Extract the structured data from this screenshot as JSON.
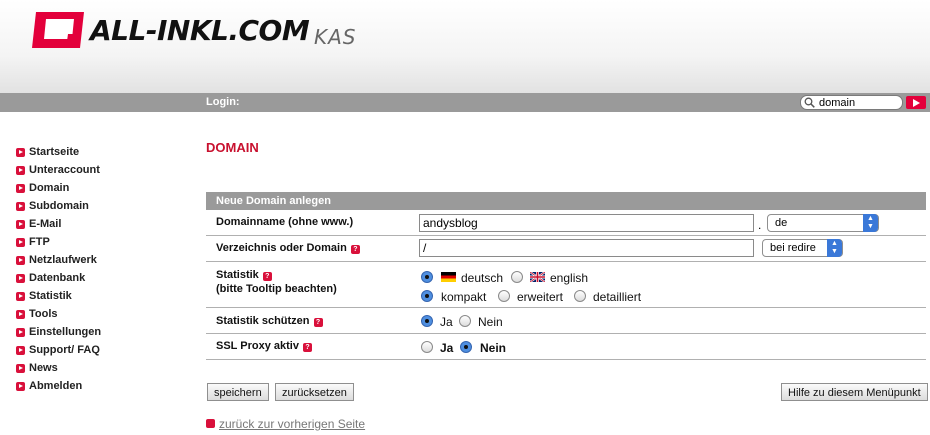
{
  "brand": {
    "logo_text": "ALL-INKL.COM",
    "product": "KAS",
    "accent": "#e3003b"
  },
  "loginbar": {
    "label": "Login:",
    "search_value": "domain"
  },
  "sidebar": {
    "items": [
      {
        "label": "Startseite"
      },
      {
        "label": "Unteraccount"
      },
      {
        "label": "Domain"
      },
      {
        "label": "Subdomain"
      },
      {
        "label": "E-Mail"
      },
      {
        "label": "FTP"
      },
      {
        "label": "Netzlaufwerk"
      },
      {
        "label": "Datenbank"
      },
      {
        "label": "Statistik"
      },
      {
        "label": "Tools"
      },
      {
        "label": "Einstellungen"
      },
      {
        "label": "Support/ FAQ"
      },
      {
        "label": "News"
      },
      {
        "label": "Abmelden"
      }
    ]
  },
  "page": {
    "title": "DOMAIN"
  },
  "form": {
    "header": "Neue Domain anlegen",
    "domainname": {
      "label": "Domainname (ohne www.)",
      "value": "andysblog",
      "dot": ".",
      "tld": "de"
    },
    "directory": {
      "label": "Verzeichnis oder Domain",
      "value": "/",
      "mode": "bei redire"
    },
    "statistik": {
      "label": "Statistik",
      "note": "(bitte Tooltip beachten)",
      "lang_de": "deutsch",
      "lang_en": "english",
      "opt_kompakt": "kompakt",
      "opt_erweitert": "erweitert",
      "opt_detailliert": "detailliert"
    },
    "protect": {
      "label": "Statistik schützen",
      "yes": "Ja",
      "no": "Nein"
    },
    "ssl": {
      "label": "SSL Proxy aktiv",
      "yes": "Ja",
      "no": "Nein"
    }
  },
  "buttons": {
    "save": "speichern",
    "reset": "zurücksetzen",
    "help": "Hilfe zu diesem Menüpunkt"
  },
  "back_link": "zurück zur vorherigen Seite"
}
